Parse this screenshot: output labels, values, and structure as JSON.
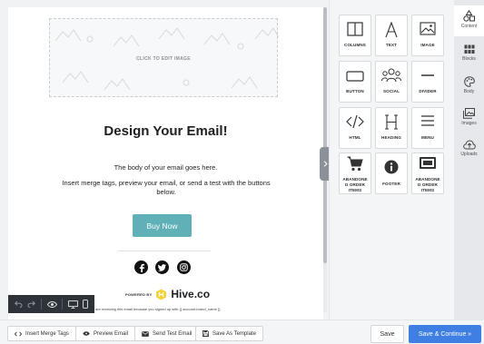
{
  "canvas": {
    "image_placeholder": "CLICK TO EDIT IMAGE",
    "headline": "Design Your Email!",
    "body_line1": "The body of your email goes here.",
    "body_line2": "Insert merge tags, preview your email, or send a test with the buttons below.",
    "button": "Buy Now",
    "powered_by": "POWERED BY",
    "brand": "Hive.co",
    "footer": "are receiving this email because you signed up with {{ account.brand_name }}",
    "colors": {
      "button": "#5fb0b7",
      "hive_logo": "#f5d23a"
    },
    "social_icons": [
      "facebook-icon",
      "twitter-icon",
      "instagram-icon"
    ]
  },
  "tools": [
    {
      "label": "COLUMNS",
      "icon": "columns-icon"
    },
    {
      "label": "TEXT",
      "icon": "text-icon"
    },
    {
      "label": "IMAGE",
      "icon": "image-icon"
    },
    {
      "label": "BUTTON",
      "icon": "button-icon"
    },
    {
      "label": "SOCIAL",
      "icon": "social-icon"
    },
    {
      "label": "DIVIDER",
      "icon": "divider-icon"
    },
    {
      "label": "HTML",
      "icon": "code-icon"
    },
    {
      "label": "HEADING",
      "icon": "heading-icon"
    },
    {
      "label": "MENU",
      "icon": "menu-icon"
    },
    {
      "label": "ABANDONE D ORDER ITEMS",
      "icon": "cart-icon"
    },
    {
      "label": "FOOTER",
      "icon": "info-icon"
    },
    {
      "label": "ABANDONE D ORDER ITEMS",
      "icon": "product-icon"
    }
  ],
  "nav": [
    {
      "label": "Content",
      "icon": "shapes-icon",
      "active": true
    },
    {
      "label": "Blocks",
      "icon": "grid-icon"
    },
    {
      "label": "Body",
      "icon": "palette-icon"
    },
    {
      "label": "Images",
      "icon": "images-icon"
    },
    {
      "label": "Uploads",
      "icon": "upload-icon"
    }
  ],
  "bottom": {
    "insert_merge_tags": "Insert Merge Tags",
    "preview_email": "Preview Email",
    "send_test_email": "Send Test Email",
    "save_as_template": "Save As Template",
    "save": "Save",
    "save_continue": "Save & Continue »"
  },
  "theme": {
    "primary": "#3f7fe3",
    "dark_toolbar": "#2d3339"
  }
}
